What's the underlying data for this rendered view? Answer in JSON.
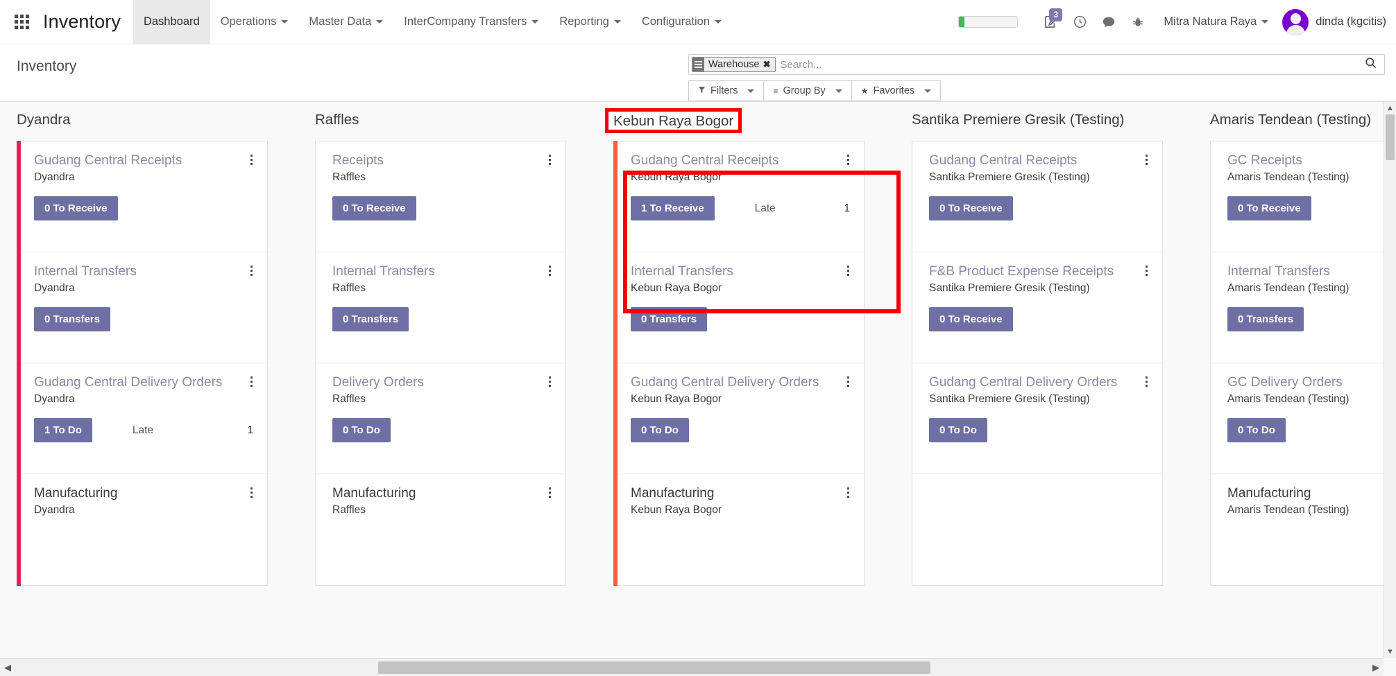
{
  "navbar": {
    "apps_icon": "apps-grid-icon",
    "brand": "Inventory",
    "menu": [
      {
        "label": "Dashboard",
        "has_caret": false,
        "active": true
      },
      {
        "label": "Operations",
        "has_caret": true,
        "active": false
      },
      {
        "label": "Master Data",
        "has_caret": true,
        "active": false
      },
      {
        "label": "InterCompany Transfers",
        "has_caret": true,
        "active": false
      },
      {
        "label": "Reporting",
        "has_caret": true,
        "active": false
      },
      {
        "label": "Configuration",
        "has_caret": true,
        "active": false
      }
    ],
    "progress_percent": 9,
    "activity_badge": "3",
    "icons": [
      "note-pencil-icon",
      "clock-icon",
      "chat-bubble-icon",
      "bug-icon"
    ],
    "company": "Mitra Natura Raya",
    "user": "dinda (kgcitis)",
    "avatar_icon": "user-avatar"
  },
  "control_panel": {
    "breadcrumb": "Inventory",
    "facet": {
      "label": "Warehouse",
      "remove": "✖",
      "icon": "group-by-icon"
    },
    "search_placeholder": "Search...",
    "search_value": "",
    "search_icon": "search-icon",
    "buttons": [
      {
        "label": "Filters",
        "icon": "funnel-icon",
        "glyph": "▼"
      },
      {
        "label": "Group By",
        "icon": "list-icon",
        "glyph": "≡"
      },
      {
        "label": "Favorites",
        "icon": "star-icon",
        "glyph": "★"
      }
    ]
  },
  "colors": {
    "accent_pink": "#e0235a",
    "accent_red": "#f4603e",
    "button_purple": "#6e6fa5",
    "annotation_red": "#f40000",
    "badge_purple": "#7c7bad",
    "progress_green": "#46b856"
  },
  "kanban": {
    "columns": [
      {
        "title": "Dyandra",
        "highlighted": false,
        "accent": "#e0235a",
        "cards": [
          {
            "title": "Gudang Central Receipts",
            "subtitle": "Dyandra",
            "button": "0 To Receive",
            "late_label": "",
            "late_count": "",
            "title_plain": false
          },
          {
            "title": "Internal Transfers",
            "subtitle": "Dyandra",
            "button": "0 Transfers",
            "late_label": "",
            "late_count": "",
            "title_plain": false
          },
          {
            "title": "Gudang Central Delivery Orders",
            "subtitle": "Dyandra",
            "button": "1 To Do",
            "late_label": "Late",
            "late_count": "1",
            "title_plain": false
          },
          {
            "title": "Manufacturing",
            "subtitle": "Dyandra",
            "button": "",
            "late_label": "",
            "late_count": "",
            "title_plain": true
          }
        ]
      },
      {
        "title": "Raffles",
        "highlighted": false,
        "accent": "",
        "cards": [
          {
            "title": "Receipts",
            "subtitle": "Raffles",
            "button": "0 To Receive",
            "late_label": "",
            "late_count": "",
            "title_plain": false
          },
          {
            "title": "Internal Transfers",
            "subtitle": "Raffles",
            "button": "0 Transfers",
            "late_label": "",
            "late_count": "",
            "title_plain": false
          },
          {
            "title": "Delivery Orders",
            "subtitle": "Raffles",
            "button": "0 To Do",
            "late_label": "",
            "late_count": "",
            "title_plain": false
          },
          {
            "title": "Manufacturing",
            "subtitle": "Raffles",
            "button": "",
            "late_label": "",
            "late_count": "",
            "title_plain": true
          }
        ]
      },
      {
        "title": "Kebun Raya Bogor",
        "highlighted": true,
        "accent": "#f4603e",
        "cards": [
          {
            "title": "Gudang Central Receipts",
            "subtitle": "Kebun Raya Bogor",
            "button": "1 To Receive",
            "late_label": "Late",
            "late_count": "1",
            "title_plain": false
          },
          {
            "title": "Internal Transfers",
            "subtitle": "Kebun Raya Bogor",
            "button": "0 Transfers",
            "late_label": "",
            "late_count": "",
            "title_plain": false
          },
          {
            "title": "Gudang Central Delivery Orders",
            "subtitle": "Kebun Raya Bogor",
            "button": "0 To Do",
            "late_label": "",
            "late_count": "",
            "title_plain": false
          },
          {
            "title": "Manufacturing",
            "subtitle": "Kebun Raya Bogor",
            "button": "",
            "late_label": "",
            "late_count": "",
            "title_plain": true
          }
        ]
      },
      {
        "title": "Santika Premiere Gresik (Testing)",
        "highlighted": false,
        "accent": "",
        "cards": [
          {
            "title": "Gudang Central Receipts",
            "subtitle": "Santika Premiere Gresik (Testing)",
            "button": "0 To Receive",
            "late_label": "",
            "late_count": "",
            "title_plain": false
          },
          {
            "title": "F&B Product Expense Receipts",
            "subtitle": "Santika Premiere Gresik (Testing)",
            "button": "0 To Receive",
            "late_label": "",
            "late_count": "",
            "title_plain": false
          },
          {
            "title": "Gudang Central Delivery Orders",
            "subtitle": "Santika Premiere Gresik (Testing)",
            "button": "0 To Do",
            "late_label": "",
            "late_count": "",
            "title_plain": false
          },
          {
            "title": "",
            "subtitle": "",
            "button": "",
            "late_label": "",
            "late_count": "",
            "title_plain": true
          }
        ]
      },
      {
        "title": "Amaris Tendean (Testing)",
        "highlighted": false,
        "accent": "",
        "cards": [
          {
            "title": "GC Receipts",
            "subtitle": "Amaris Tendean (Testing)",
            "button": "0 To Receive",
            "late_label": "",
            "late_count": "",
            "title_plain": false
          },
          {
            "title": "Internal Transfers",
            "subtitle": "Amaris Tendean (Testing)",
            "button": "0 Transfers",
            "late_label": "",
            "late_count": "",
            "title_plain": false
          },
          {
            "title": "GC Delivery Orders",
            "subtitle": "Amaris Tendean (Testing)",
            "button": "0 To Do",
            "late_label": "",
            "late_count": "",
            "title_plain": false
          },
          {
            "title": "Manufacturing",
            "subtitle": "Amaris Tendean (Testing)",
            "button": "",
            "late_label": "",
            "late_count": "",
            "title_plain": true
          }
        ]
      }
    ]
  },
  "scrollbars": {
    "horizontal_left_arrow": "◀",
    "horizontal_right_arrow": "▶",
    "vertical_up_arrow": "▲",
    "vertical_down_arrow": "▼"
  }
}
